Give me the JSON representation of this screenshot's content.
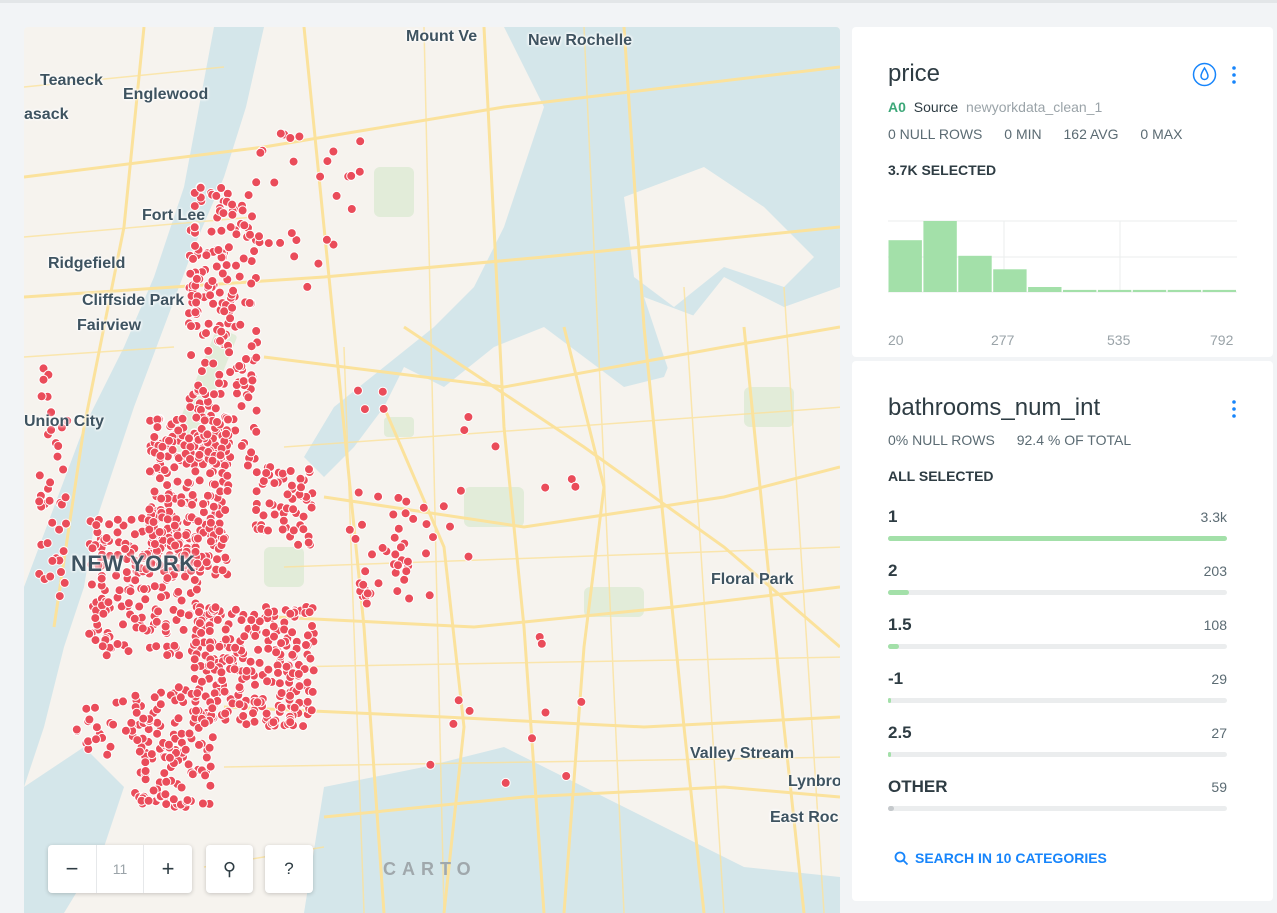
{
  "map": {
    "labels": [
      "Mount Ve",
      "New Rochelle",
      "Teaneck",
      "Englewood",
      "asack",
      "Fort Lee",
      "Ridgefield",
      "Cliffside Park",
      "Fairview",
      "Union City",
      "NEW YORK",
      "Floral Park",
      "Valley Stream",
      "Lynbro",
      "East Roc"
    ],
    "zoom_level": "11",
    "zoom_out_label": "−",
    "zoom_in_label": "+",
    "search_label": "⚲",
    "help_label": "?",
    "attribution": "CARTO",
    "colors": {
      "land": "#f6f3ee",
      "water": "#d4e6ea",
      "park": "#e2ecd9",
      "road": "#fbe29c",
      "point": "#ea4c5a"
    }
  },
  "price_widget": {
    "title": "price",
    "layer_id": "A0",
    "source_label": "Source",
    "source_name": "newyorkdata_clean_1",
    "null_rows": "0 NULL ROWS",
    "min": "0 MIN",
    "avg": "162 AVG",
    "max": "0 MAX",
    "selected": "3.7K SELECTED",
    "histogram_fractions": [
      0.73,
      1.0,
      0.51,
      0.32,
      0.07,
      0.03,
      0.03,
      0.03,
      0.03,
      0.03
    ],
    "x_labels": [
      "20",
      "277",
      "535",
      "792"
    ],
    "bar_color": "#a3e0a9"
  },
  "bathrooms_widget": {
    "title": "bathrooms_num_int",
    "null_rows": "0% NULL ROWS",
    "of_total": "92.4 % OF TOTAL",
    "selected": "ALL SELECTED",
    "categories": [
      {
        "name": "1",
        "value": "3.3k",
        "fraction": 1.0
      },
      {
        "name": "2",
        "value": "203",
        "fraction": 0.062
      },
      {
        "name": "1.5",
        "value": "108",
        "fraction": 0.033
      },
      {
        "name": "-1",
        "value": "29",
        "fraction": 0.009
      },
      {
        "name": "2.5",
        "value": "27",
        "fraction": 0.008
      },
      {
        "name": "OTHER",
        "value": "59",
        "fraction": 0.018
      }
    ],
    "search_label": "SEARCH IN 10 CATEGORIES"
  }
}
